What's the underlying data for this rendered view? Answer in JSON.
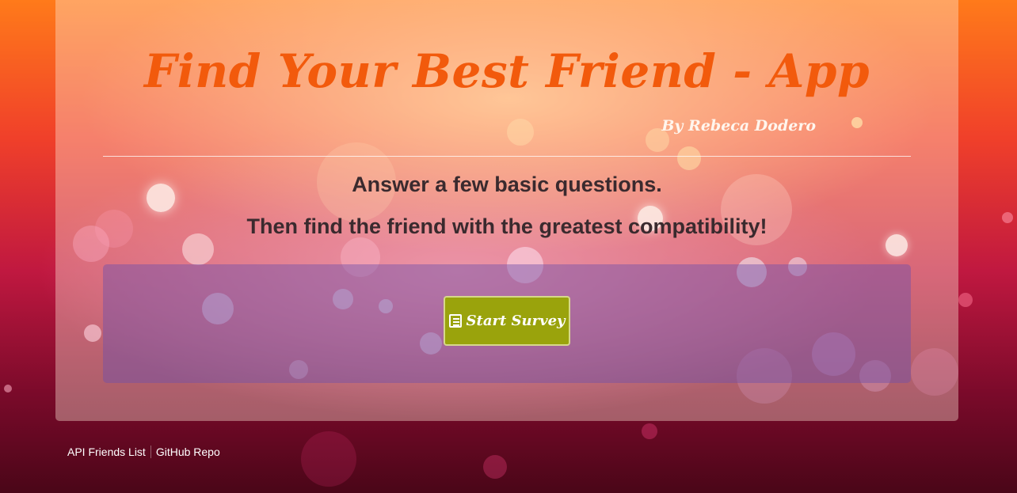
{
  "header": {
    "title": "Find Your Best Friend - App",
    "byline": "By Rebeca Dodero"
  },
  "intro": {
    "line1": "Answer a few basic questions.",
    "line2": "Then find the friend with the greatest compatibility!"
  },
  "survey": {
    "button_label": "Start Survey",
    "button_icon": "list-alt-icon"
  },
  "footer": {
    "links": [
      "API Friends List",
      "GitHub Repo"
    ]
  },
  "colors": {
    "title": "#f25a0c",
    "button": "#9aa30c",
    "text": "#3a2a2e"
  }
}
